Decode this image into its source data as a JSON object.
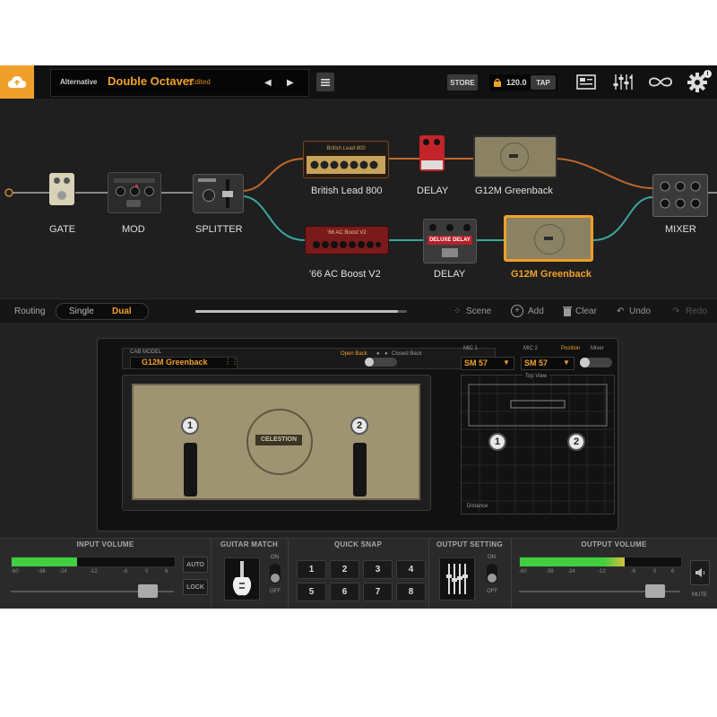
{
  "preset": {
    "bank": "Alternative",
    "name": "Double Octaver",
    "edited": "*Edited"
  },
  "header": {
    "store_label": "STORE",
    "tempo": "120.0",
    "tap_label": "TAP"
  },
  "chain": {
    "gate": "GATE",
    "mod": "MOD",
    "splitter": "SPLITTER",
    "amp1": "British Lead 800",
    "delay1": "DELAY",
    "cab1": "G12M Greenback",
    "amp2": "'66 AC Boost V2",
    "delay2": "DELAY",
    "cab2": "G12M Greenback",
    "mixer": "MIXER",
    "amp1_plate": "British Lead 800",
    "amp2_plate": "'66 AC Boost V2",
    "delay2_plate": "DELUXE DELAY"
  },
  "routing": {
    "label": "Routing",
    "single": "Single",
    "dual": "Dual"
  },
  "toolbar": {
    "scene": "Scene",
    "add": "Add",
    "clear": "Clear",
    "undo": "Undo",
    "redo": "Redo"
  },
  "cab": {
    "model_label": "CAB MODEL",
    "model": "G12M Greenback",
    "open_back": "Open Back",
    "closed_back": "Closed Back",
    "brand": "CELESTION",
    "mic1_num": "1",
    "mic2_num": "2"
  },
  "mics": {
    "mic1_label": "MIC 1",
    "mic2_label": "MIC 2",
    "mic1": "SM 57",
    "mic2": "SM 57",
    "position": "Position",
    "mixer": "Mixer",
    "top_view": "Top View",
    "distance": "Distance"
  },
  "bottom": {
    "input_volume": "INPUT VOLUME",
    "guitar_match": "GUITAR MATCH",
    "quick_snap": "QUICK SNAP",
    "output_setting": "OUTPUT SETTING",
    "output_volume": "OUTPUT VOLUME",
    "auto": "AUTO",
    "lock": "LOCK",
    "on": "ON",
    "off": "OFF",
    "mute": "MUTE",
    "scale": [
      "-60",
      "-36",
      "-24",
      "-12",
      "-6",
      "0",
      "6"
    ],
    "snaps": [
      "1",
      "2",
      "3",
      "4",
      "5",
      "6",
      "7",
      "8"
    ],
    "input_level": 0.4,
    "output_level": 0.65
  },
  "colors": {
    "accent": "#f0a02a",
    "wire_top": "#c0692a",
    "wire_bottom": "#3aa59a",
    "meter": "#3fcf3f"
  }
}
